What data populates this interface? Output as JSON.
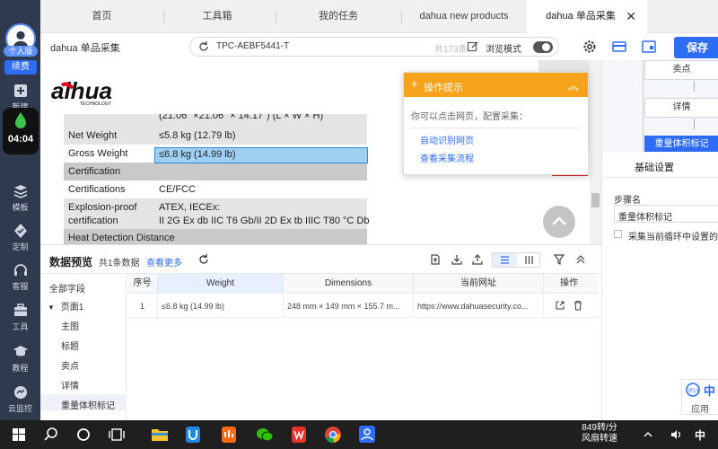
{
  "sidebar": {
    "user_name": "个人版",
    "renew_label": "续费",
    "new_label": "新建",
    "timer": "04:04",
    "items": [
      {
        "label": "模板",
        "icon": "template-icon"
      },
      {
        "label": "定制",
        "icon": "custom-icon"
      },
      {
        "label": "客服",
        "icon": "headset-icon"
      },
      {
        "label": "工具",
        "icon": "toolbox-icon"
      },
      {
        "label": "教程",
        "icon": "tutorial-icon"
      },
      {
        "label": "云监控",
        "icon": "cloud-monitor-icon"
      }
    ]
  },
  "tabs": [
    {
      "label": "首页"
    },
    {
      "label": "工具箱"
    },
    {
      "label": "我的任务"
    },
    {
      "label": "dahua new products"
    },
    {
      "label": "dahua 单品采集",
      "active": true
    }
  ],
  "toolbar": {
    "title": "dahua 单品采集",
    "url": "TPC-AEBF5441-T",
    "count": "共173条",
    "browse_mode": "浏览模式",
    "save_label": "保存"
  },
  "webpage": {
    "logo_text": "alhua",
    "logo_sub": "TECHNOLOGY",
    "cut_row": "(21.06\" ×21.06\" × 14.17\") (L × W × H)",
    "rows": [
      {
        "key": "Net Weight",
        "value": "≤5.8 kg (12.79 lb)"
      },
      {
        "key": "Gross Weight",
        "value": "≤6.8 kg (14.99 lb)"
      },
      {
        "key": "Certification",
        "value": ""
      },
      {
        "key": "Certifications",
        "value": "CE/FCC"
      },
      {
        "key": "Explosion-proof",
        "key2": "certification",
        "value": "ATEX, IECEx:",
        "value2": "II 2G Ex db IIC T6 Gb/II 2D Ex tb IIIC T80 °C Db"
      },
      {
        "key": "Heat Detection Distance",
        "value": ""
      }
    ]
  },
  "hint": {
    "title": "操作提示",
    "body": "你可以点击网页，配置采集：",
    "link1": "自动识别网页",
    "link2": "查看采集流程"
  },
  "right_panel": {
    "flow": [
      "卖点",
      "详情",
      "重量体积标记"
    ],
    "tab": "基础设置",
    "step_label": "步骤名",
    "step_value": "重量体积标记",
    "checkbox_label": "采集当前循环中设置的元",
    "app_label": "应用",
    "app_zh": "中"
  },
  "preview": {
    "title": "数据预览",
    "count": "共1条数据",
    "more": "查看更多",
    "tree": {
      "all_fields": "全部字段",
      "page": "页面1",
      "children": [
        "主图",
        "标题",
        "卖点",
        "详情",
        "重量体积标记"
      ]
    },
    "columns": [
      "序号",
      "Weight",
      "Dimensions",
      "当前网址",
      "操作"
    ],
    "rows": [
      {
        "idx": "1",
        "weight": "≤6.8 kg (14.99 lb)",
        "dimensions": "248 mm × 149 mm × 155.7 m...",
        "url": "https://www.dahuasecurity.co..."
      }
    ]
  },
  "taskbar": {
    "speed": "849转/分",
    "fan": "风扇转速",
    "ime": "中"
  }
}
